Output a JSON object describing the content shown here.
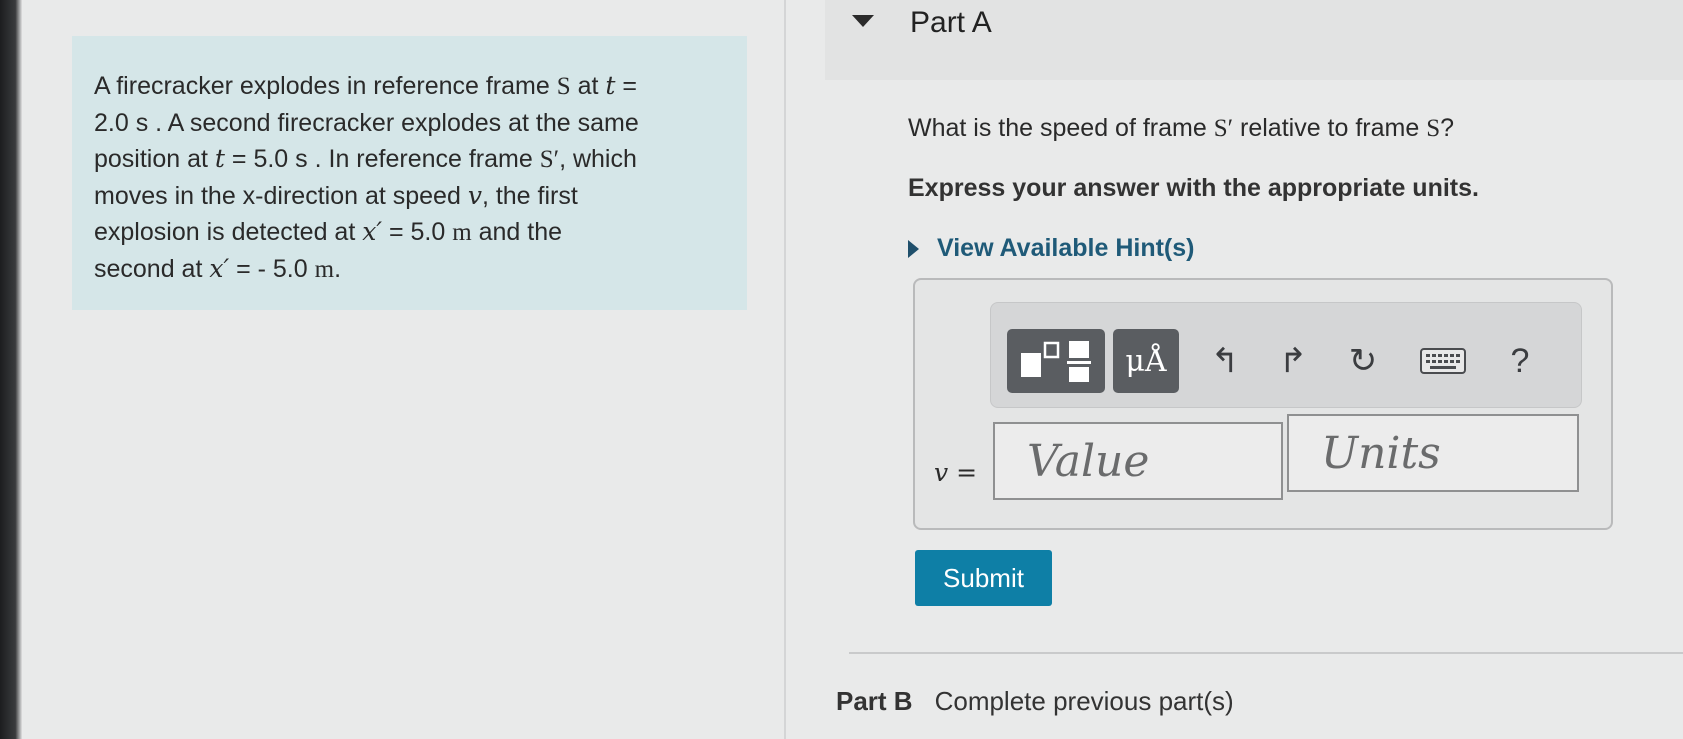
{
  "problem": {
    "lines": [
      [
        {
          "t": "A firecracker explodes in reference frame "
        },
        {
          "r": "S"
        },
        {
          "t": " at "
        },
        {
          "m": "t"
        },
        {
          "t": " ="
        }
      ],
      [
        {
          "t": "2.0 s . A second firecracker explodes at the same"
        }
      ],
      [
        {
          "t": "position at "
        },
        {
          "m": "t"
        },
        {
          "t": " = 5.0 s . In reference frame "
        },
        {
          "r": "S′"
        },
        {
          "t": ", which"
        }
      ],
      [
        {
          "t": "moves in the x-direction at speed "
        },
        {
          "m": "v"
        },
        {
          "t": ", the first"
        }
      ],
      [
        {
          "t": "explosion is detected at "
        },
        {
          "m": "x′"
        },
        {
          "t": " = 5.0 "
        },
        {
          "r": "m"
        },
        {
          "t": " and the"
        }
      ],
      [
        {
          "t": "second at "
        },
        {
          "m": "x′"
        },
        {
          "t": " = - 5.0 "
        },
        {
          "r": "m"
        },
        {
          "t": "."
        }
      ]
    ]
  },
  "part_a": {
    "title": "Part A",
    "question_pre": "What is the speed of frame ",
    "question_frame1": "S′",
    "question_mid": " relative to frame ",
    "question_frame2": "S",
    "question_post": "?",
    "instruction": "Express your answer with the appropriate units.",
    "hint_label": "View Available Hint(s)",
    "toolbar": {
      "symbols_label": "μÅ",
      "undo_glyph": "↰",
      "redo_glyph": "↱",
      "reset_glyph": "↻",
      "help_label": "?"
    },
    "variable_label": "v =",
    "value_placeholder": "Value",
    "units_placeholder": "Units",
    "submit_label": "Submit"
  },
  "part_b": {
    "title": "Part B",
    "status": "Complete previous part(s)"
  },
  "colors": {
    "problem_bg": "#d5e6e8",
    "submit_bg": "#0e7fa6",
    "hint_text": "#1f5a78"
  }
}
